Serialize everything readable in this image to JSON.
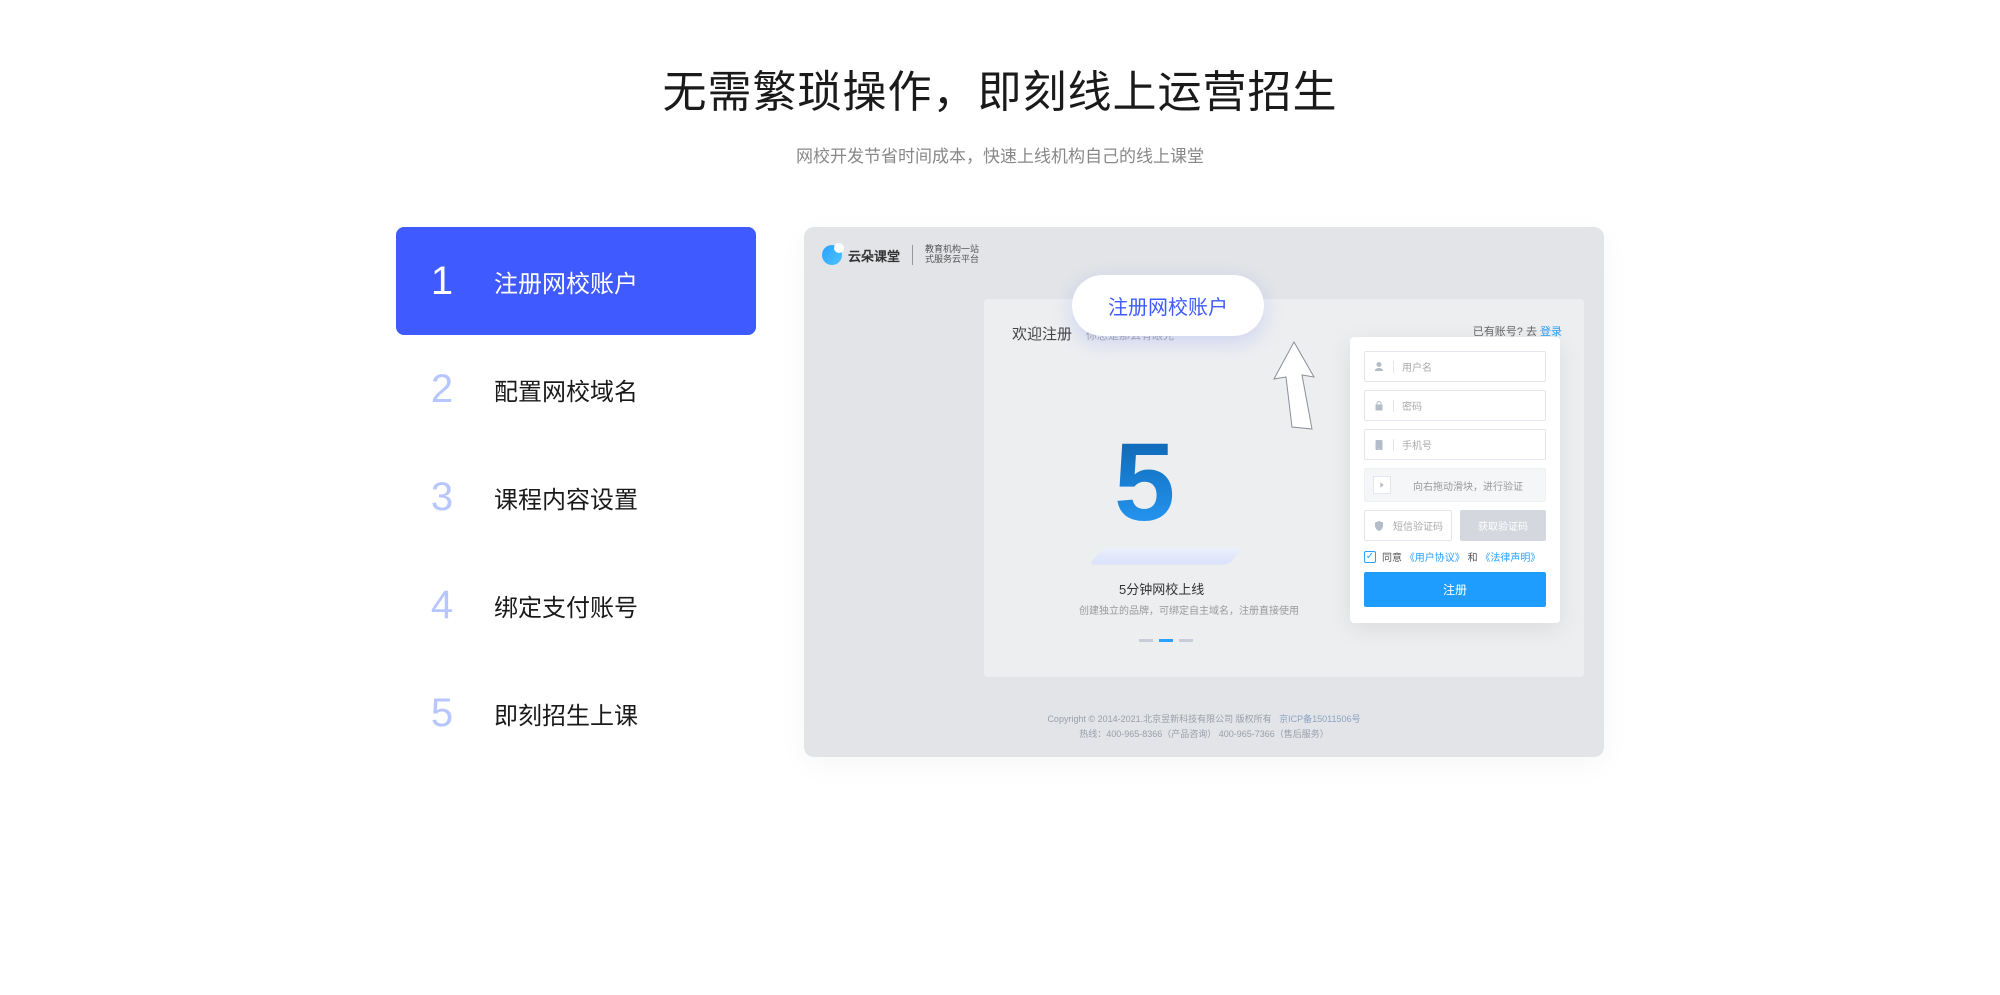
{
  "header": {
    "title": "无需繁琐操作，即刻线上运营招生",
    "subtitle": "网校开发节省时间成本，快速上线机构自己的线上课堂"
  },
  "steps": [
    {
      "num": "1",
      "label": "注册网校账户",
      "active": true
    },
    {
      "num": "2",
      "label": "配置网校域名",
      "active": false
    },
    {
      "num": "3",
      "label": "课程内容设置",
      "active": false
    },
    {
      "num": "4",
      "label": "绑定支付账号",
      "active": false
    },
    {
      "num": "5",
      "label": "即刻招生上课",
      "active": false
    }
  ],
  "preview": {
    "logo_text": "云朵课堂",
    "logo_sub_line1": "教育机构一站",
    "logo_sub_line2": "式服务云平台",
    "callout": "注册网校账户",
    "reg_title": "欢迎注册",
    "reg_slogan": "你总是那么有眼光~",
    "have_account": "已有账号? 去 ",
    "login_link": "登录",
    "big_five": "5",
    "five_min_title": "5分钟网校上线",
    "five_min_sub": "创建独立的品牌，可绑定自主域名，注册直接使用",
    "form": {
      "username_placeholder": "用户名",
      "password_placeholder": "密码",
      "phone_placeholder": "手机号",
      "slider_text": "向右拖动滑块，进行验证",
      "sms_placeholder": "短信验证码",
      "get_code": "获取验证码",
      "agree_prefix": "同意",
      "user_agreement": "《用户协议》",
      "and": "和",
      "legal": "《法律声明》",
      "submit": "注册"
    },
    "footer": {
      "line1_prefix": "Copyright © 2014-2021.北京昱新科技有限公司 版权所有",
      "icp": "京ICP备15011506号",
      "line2": "热线：400-965-8366（产品咨询） 400-965-7366（售后服务）"
    }
  }
}
